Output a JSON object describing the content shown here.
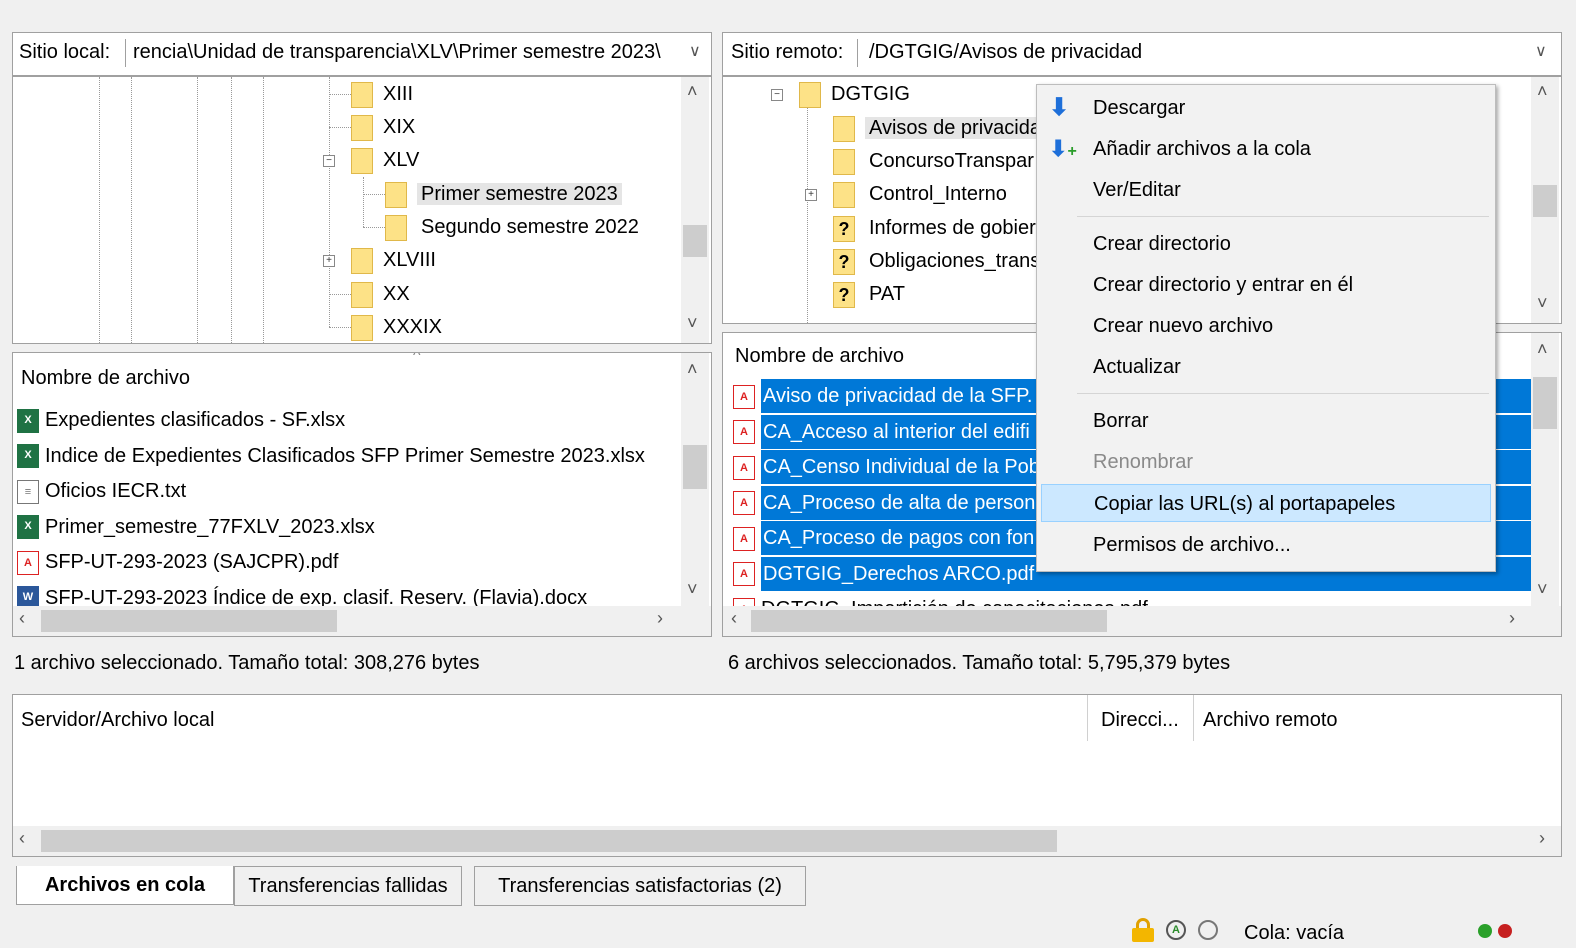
{
  "local": {
    "site_label": "Sitio local:",
    "path": "rencia\\Unidad de transparencia\\XLV\\Primer semestre 2023\\",
    "tree": [
      "XIII",
      "XIX",
      "XLV",
      "Primer semestre 2023",
      "Segundo semestre 2022",
      "XLVIII",
      "XX",
      "XXXIX"
    ],
    "file_header": "Nombre de archivo",
    "files": [
      {
        "name": "Expedientes clasificados - SF.xlsx",
        "icon": "excel-icon"
      },
      {
        "name": "Indice de Expedientes Clasificados SFP Primer Semestre 2023.xlsx",
        "icon": "excel-icon"
      },
      {
        "name": "Oficios IECR.txt",
        "icon": "text-file-icon"
      },
      {
        "name": "Primer_semestre_77FXLV_2023.xlsx",
        "icon": "excel-icon"
      },
      {
        "name": "SFP-UT-293-2023 (SAJCPR).pdf",
        "icon": "pdf-icon"
      },
      {
        "name": "SFP-UT-293-2023 Índice de exp. clasif. Reserv. (Flavia).docx",
        "icon": "word-icon"
      }
    ],
    "status": "1 archivo seleccionado. Tamaño total: 308,276 bytes"
  },
  "remote": {
    "site_label": "Sitio remoto:",
    "path": "/DGTGIG/Avisos de privacidad",
    "tree": [
      "DGTGIG",
      "Avisos de privacida",
      "ConcursoTranspar",
      "Control_Interno",
      "Informes de gobier",
      "Obligaciones_trans",
      "PAT"
    ],
    "file_header": "Nombre de archivo",
    "files": [
      "Aviso de privacidad de la SFP.",
      "CA_Acceso al interior del edifi",
      "CA_Censo Individual de la Pob",
      "CA_Proceso de alta de person",
      "CA_Proceso de pagos con fon",
      "DGTGIG_Derechos ARCO.pdf",
      "DGTGIG_Impartición de capacitaciones.pdf"
    ],
    "status": "6 archivos seleccionados. Tamaño total: 5,795,379 bytes"
  },
  "context_menu": {
    "items": [
      "Descargar",
      "Añadir archivos a la cola",
      "Ver/Editar",
      "Crear directorio",
      "Crear directorio y entrar en él",
      "Crear nuevo archivo",
      "Actualizar",
      "Borrar",
      "Renombrar",
      "Copiar las URL(s) al portapapeles",
      "Permisos de archivo..."
    ]
  },
  "queue": {
    "col_server": "Servidor/Archivo local",
    "col_direction": "Direcci...",
    "col_remote": "Archivo remoto"
  },
  "tabs": [
    "Archivos en cola",
    "Transferencias fallidas",
    "Transferencias satisfactorias (2)"
  ],
  "statusbar": {
    "queue": "Cola: vacía"
  },
  "colors": {
    "selection": "#0078d7",
    "hover": "#cce8ff"
  }
}
